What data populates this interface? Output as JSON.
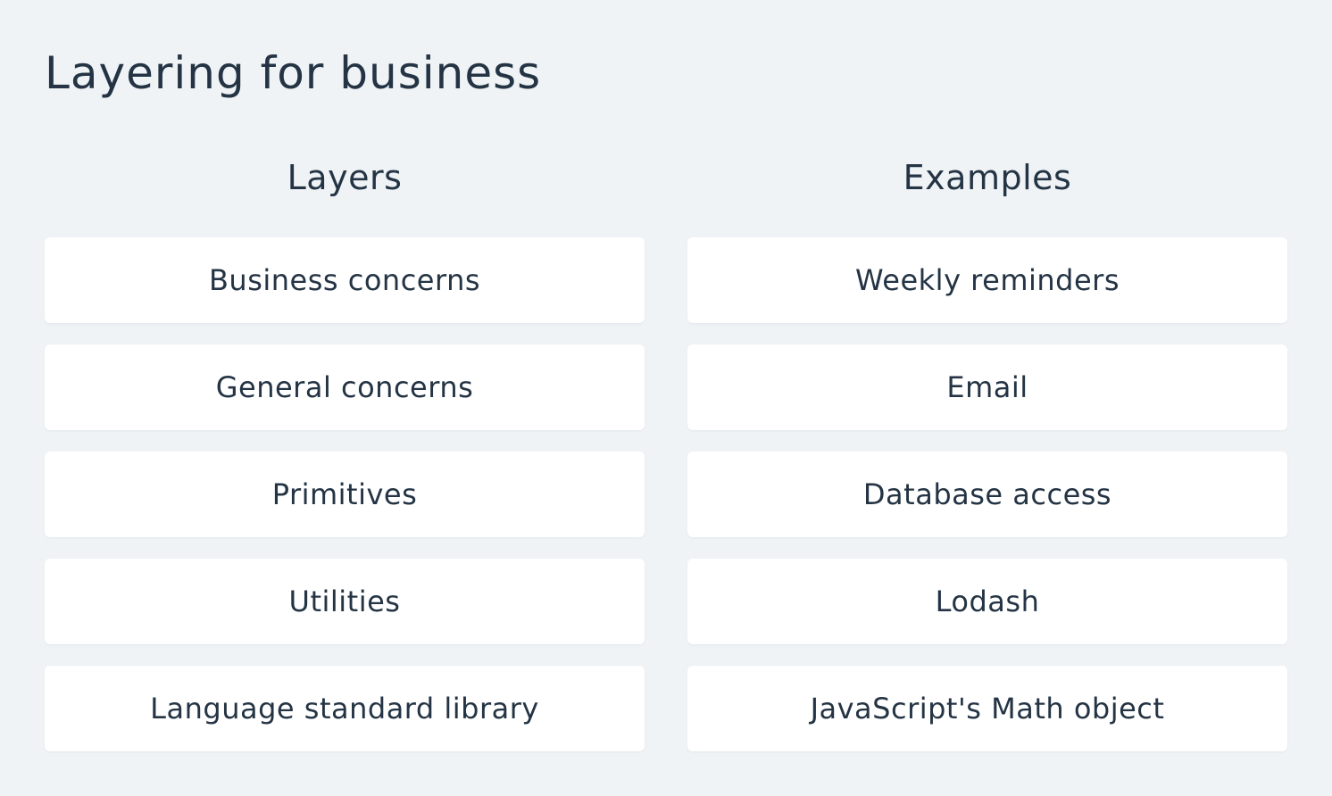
{
  "title": "Layering for business",
  "layers": {
    "header": "Layers",
    "items": [
      "Business concerns",
      "General concerns",
      "Primitives",
      "Utilities",
      "Language standard library"
    ]
  },
  "examples": {
    "header": "Examples",
    "items": [
      "Weekly reminders",
      "Email",
      "Database access",
      "Lodash",
      "JavaScript's Math object"
    ]
  },
  "colors": {
    "background": "#eff3f6",
    "card": "#ffffff",
    "text": "#243444"
  }
}
